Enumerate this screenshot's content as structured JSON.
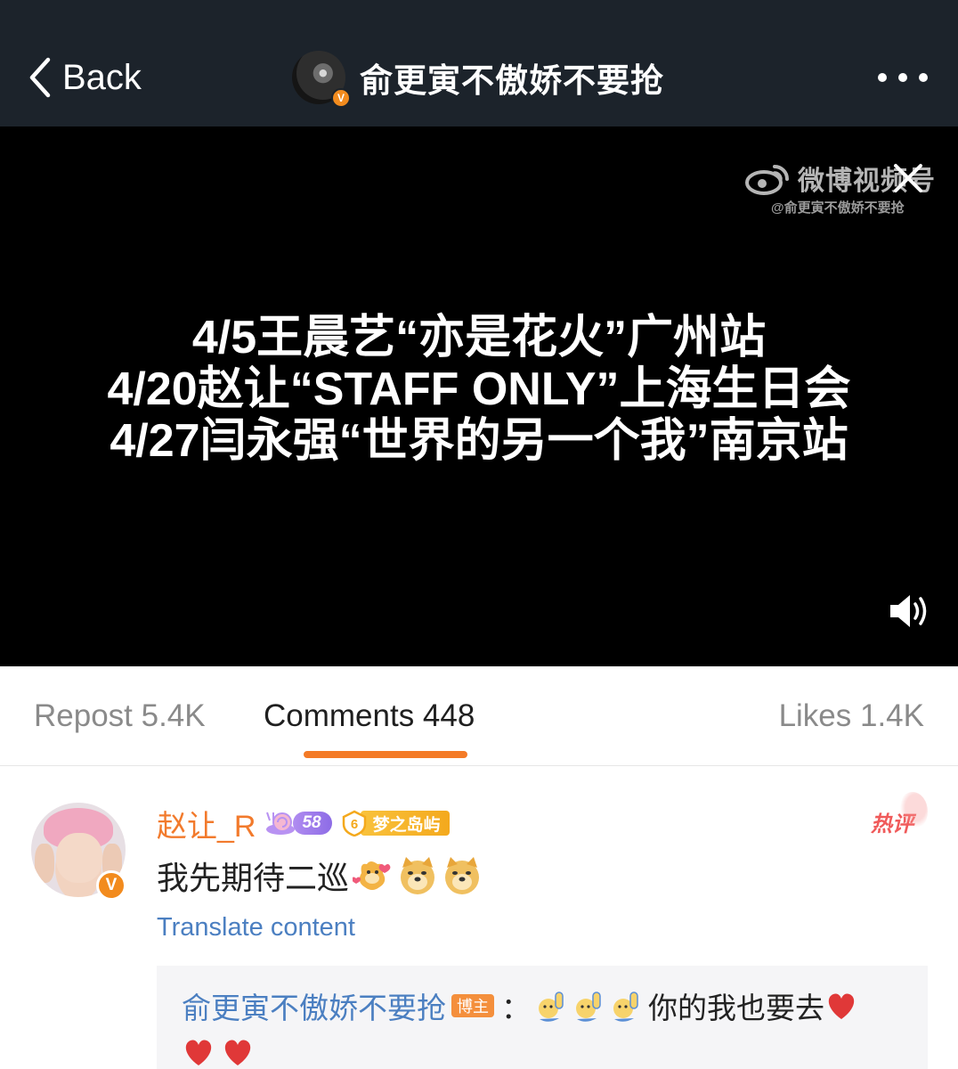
{
  "header": {
    "back_label": "Back",
    "title": "俞更寅不傲娇不要抢",
    "verified_badge": "V",
    "background_color": "#1c232b"
  },
  "video": {
    "watermark_brand": "微博视频号",
    "watermark_handle": "@俞更寅不傲娇不要抢",
    "subtitles": [
      "4/5王晨艺“亦是花火”广州站",
      "4/20赵让“STAFF ONLY”上海生日会",
      "4/27闫永强“世界的另一个我”南京站"
    ],
    "icons": [
      "weibo-logo-icon",
      "close-icon",
      "sound-icon"
    ]
  },
  "tabs": {
    "repost_label": "Repost 5.4K",
    "comments_label": "Comments 448",
    "likes_label": "Likes 1.4K",
    "active_tab": "comments",
    "accent_color": "#f47a26"
  },
  "comment": {
    "username": "赵让_R",
    "verified_badge": "V",
    "level": "58",
    "fan_level": "6",
    "fan_group": "梦之岛屿",
    "hot_tag": "热评",
    "text": "我先期待二巡",
    "emojis": [
      "dancing-doge-icon",
      "doge-icon",
      "doge-icon"
    ],
    "translate_label": "Translate content",
    "name_color": "#f27a2c",
    "link_color": "#4b7fc1"
  },
  "reply": {
    "author": "俞更寅不傲娇不要抢",
    "author_tag": "博主",
    "colon": "：",
    "text": "你的我也要去",
    "emojis_before": [
      "raised-hand-icon",
      "raised-hand-icon",
      "raised-hand-icon"
    ],
    "emojis_after": [
      "heart-icon",
      "heart-icon",
      "heart-icon"
    ]
  }
}
